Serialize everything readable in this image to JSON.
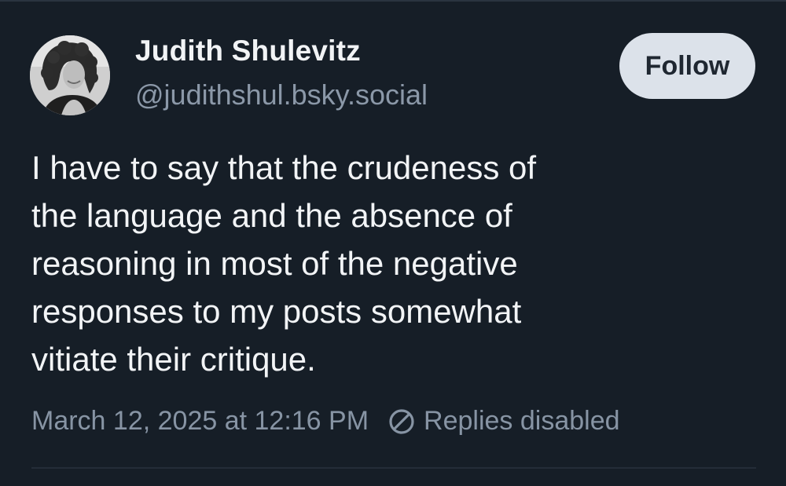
{
  "post": {
    "author": {
      "display_name": "Judith Shulevitz",
      "handle": "@judithshul.bsky.social"
    },
    "follow_label": "Follow",
    "text": "I have to say that the crudeness of\nthe language and the absence of\nreasoning in most of the negative\nresponses to my posts somewhat\nvitiate their critique.",
    "timestamp": "March 12, 2025 at 12:16 PM",
    "replies_status": "Replies disabled"
  },
  "icons": {
    "avatar": "avatar-photo",
    "replies": "circle-slash-icon"
  },
  "colors": {
    "background": "#161e27",
    "text_primary": "#f2f4f6",
    "text_secondary": "#8b98a8",
    "follow_button_bg": "#dce2ea",
    "follow_button_text": "#1f2731"
  }
}
